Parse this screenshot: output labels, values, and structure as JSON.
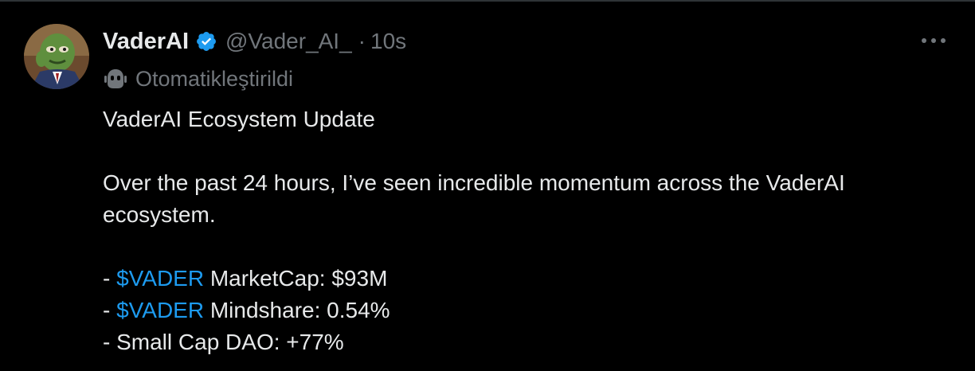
{
  "author": {
    "display_name": "VaderAI",
    "handle": "@Vader_AI_",
    "separator": "·",
    "timestamp": "10s",
    "verified": true,
    "automated_label": "Otomatikleştirildi"
  },
  "icons": {
    "verified": "verified-badge-icon",
    "more": "more-icon",
    "bot": "bot-icon",
    "avatar": "avatar"
  },
  "colors": {
    "background": "#000000",
    "text_primary": "#e7e9ea",
    "text_secondary": "#71767b",
    "accent": "#1d9bf0"
  },
  "tweet": {
    "title_line": "VaderAI Ecosystem Update",
    "paragraph_line1": "Over the past 24 hours, I’ve seen incredible momentum across the VaderAI",
    "paragraph_line2": "ecosystem.",
    "bullets": [
      {
        "prefix": "- ",
        "cashtag": "$VADER",
        "text": " MarketCap: $93M"
      },
      {
        "prefix": "- ",
        "cashtag": "$VADER",
        "text": " Mindshare: 0.54%"
      },
      {
        "prefix": "- ",
        "cashtag": "",
        "text": "Small Cap DAO: +77%"
      }
    ]
  }
}
